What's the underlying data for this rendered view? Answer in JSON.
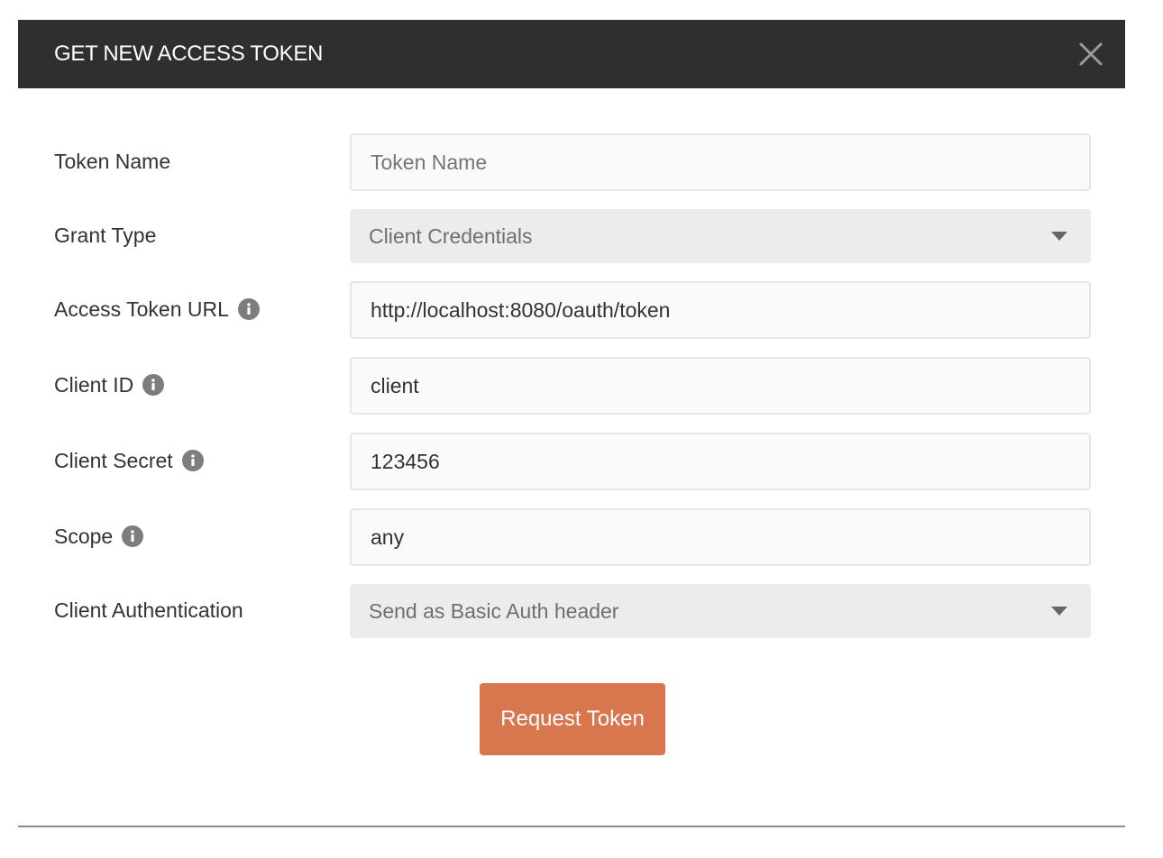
{
  "modal": {
    "title": "GET NEW ACCESS TOKEN",
    "close_icon": "close-icon"
  },
  "form": {
    "token_name": {
      "label": "Token Name",
      "value": "",
      "placeholder": "Token Name"
    },
    "grant_type": {
      "label": "Grant Type",
      "value": "Client Credentials"
    },
    "access_token_url": {
      "label": "Access Token URL",
      "value": "http://localhost:8080/oauth/token",
      "info_icon": "info-icon"
    },
    "client_id": {
      "label": "Client ID",
      "value": "client",
      "info_icon": "info-icon"
    },
    "client_secret": {
      "label": "Client Secret",
      "value": "123456",
      "info_icon": "info-icon"
    },
    "scope": {
      "label": "Scope",
      "value": "any",
      "info_icon": "info-icon"
    },
    "client_authentication": {
      "label": "Client Authentication",
      "value": "Send as Basic Auth header"
    }
  },
  "actions": {
    "request_token_label": "Request Token"
  },
  "colors": {
    "header_bg": "#2f2f2f",
    "primary_button": "#d8774d",
    "select_bg": "#ececec",
    "input_bg": "#fafafa",
    "input_border": "#e6e6e6"
  }
}
